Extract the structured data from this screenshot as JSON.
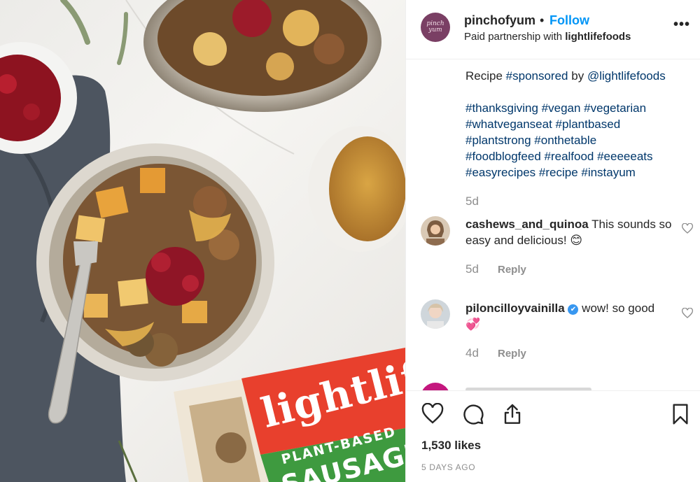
{
  "post": {
    "username": "pinchofyum",
    "separator": "•",
    "follow_label": "Follow",
    "partnership_prefix": "Paid partnership with",
    "partner": "lightlifefoods",
    "more_label": "•••",
    "avatar_text_line1": "pinch",
    "avatar_text_line2": "yum"
  },
  "caption": {
    "prefix": "Recipe",
    "sponsored_tag": "#sponsored",
    "by": "by",
    "mention": "@lightlifefoods",
    "hashtag_lines": [
      "#thanksgiving #vegan #vegetarian",
      "#whatveganseat #plantbased",
      "#plantstrong #onthetable",
      "#foodblogfeed #realfood #eeeeeats",
      "#easyrecipes #recipe #instayum"
    ],
    "age": "5d"
  },
  "comments": [
    {
      "username": "cashews_and_quinoa",
      "text": "This sounds so easy and delicious!",
      "emoji": "😊",
      "age": "5d",
      "reply_label": "Reply"
    },
    {
      "username": "piloncilloyvainilla",
      "verified": "✔",
      "text": "wow! so good",
      "emoji": "💞",
      "age": "4d",
      "reply_label": "Reply"
    }
  ],
  "footer": {
    "likes": "1,530 likes",
    "date": "5 DAYS AGO"
  },
  "product": {
    "brand": "lightlife",
    "line1": "PLANT-BASED",
    "line2": "SAUSAGE"
  },
  "colors": {
    "link": "#0095f6",
    "hashtag": "#00376b",
    "muted": "#8e8e8e",
    "brand_red": "#e8402d",
    "brand_green": "#3e9a3f"
  },
  "icons": [
    "heart-icon",
    "comment-icon",
    "share-icon",
    "bookmark-icon",
    "more-icon",
    "verified-icon"
  ]
}
